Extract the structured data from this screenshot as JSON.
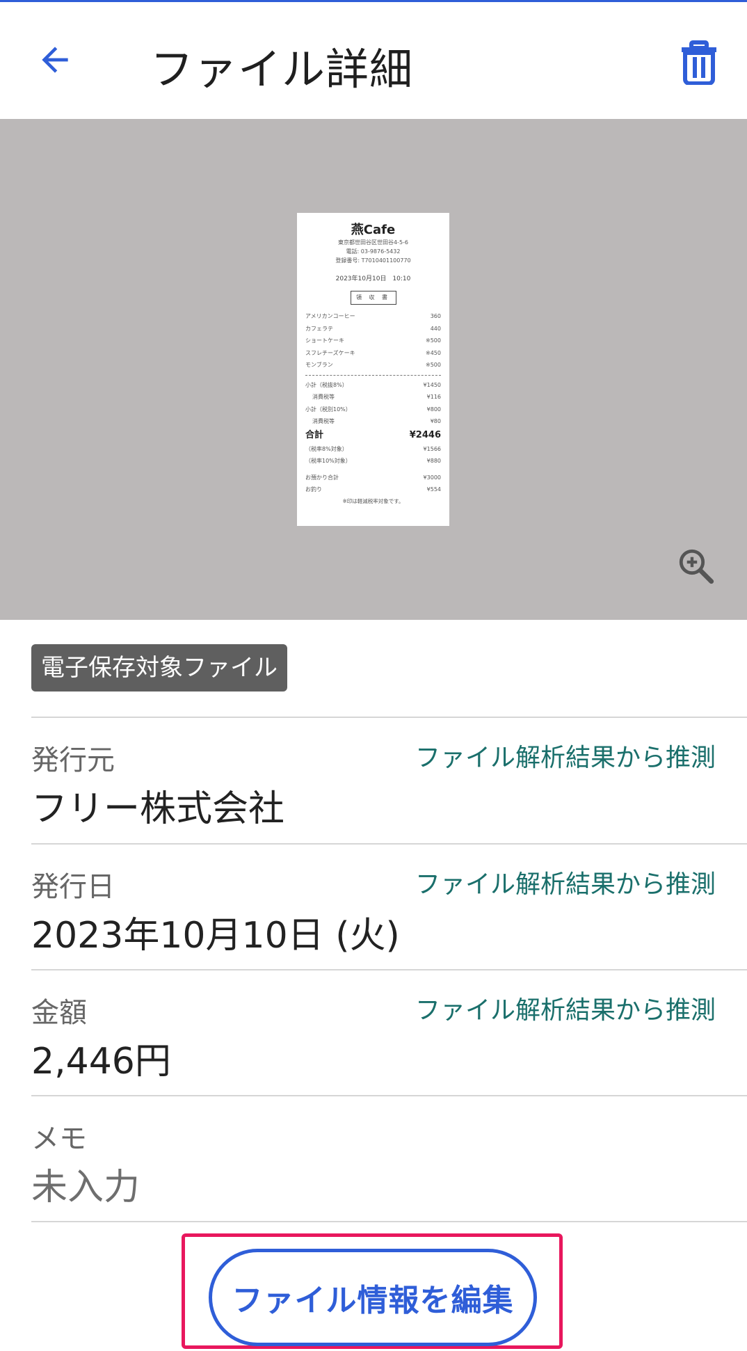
{
  "header": {
    "title": "ファイル詳細",
    "back_icon": "arrow-left-icon",
    "delete_icon": "trash-icon",
    "accent_color": "#2f5ed8"
  },
  "preview": {
    "zoom_icon": "zoom-in-icon",
    "receipt": {
      "shop": "燕Cafe",
      "address": "東京都世田谷区世田谷4-5-6",
      "phone": "電話: 03-9876-5432",
      "registration": "登録番号: T7010401100770",
      "datetime": "2023年10月10日　10:10",
      "doc_type": "領 収 書",
      "items": [
        {
          "name": "アメリカンコーヒー",
          "price": "360"
        },
        {
          "name": "カフェラテ",
          "price": "440"
        },
        {
          "name": "ショートケーキ",
          "price": "※500"
        },
        {
          "name": "スフレチーズケーキ",
          "price": "※450"
        },
        {
          "name": "モンブラン",
          "price": "※500"
        }
      ],
      "subtotals": [
        {
          "name": "小計（税抜8%）",
          "price": "¥1450"
        },
        {
          "name": "消費税等",
          "price": "¥116"
        },
        {
          "name": "小計（税別10%）",
          "price": "¥800"
        },
        {
          "name": "消費税等",
          "price": "¥80"
        }
      ],
      "total_label": "合計",
      "total_value": "¥2446",
      "breakdown": [
        {
          "name": "（税率8%対象）",
          "price": "¥1566"
        },
        {
          "name": "（税率10%対象）",
          "price": "¥880"
        }
      ],
      "payment": [
        {
          "name": "お預かり合計",
          "price": "¥3000"
        },
        {
          "name": "お釣り",
          "price": "¥554"
        }
      ],
      "note": "※印は軽減税率対象です。"
    }
  },
  "badge": "電子保存対象ファイル",
  "fields": {
    "issuer": {
      "label": "発行元",
      "value": "フリー株式会社",
      "hint": "ファイル解析結果から推測"
    },
    "date": {
      "label": "発行日",
      "value": "2023年10月10日 (火)",
      "hint": "ファイル解析結果から推測"
    },
    "amount": {
      "label": "金額",
      "value": "2,446円",
      "hint": "ファイル解析結果から推測"
    },
    "memo": {
      "label": "メモ",
      "value": "未入力"
    }
  },
  "edit_button": "ファイル情報を編集",
  "highlight_color": "#e8175d"
}
